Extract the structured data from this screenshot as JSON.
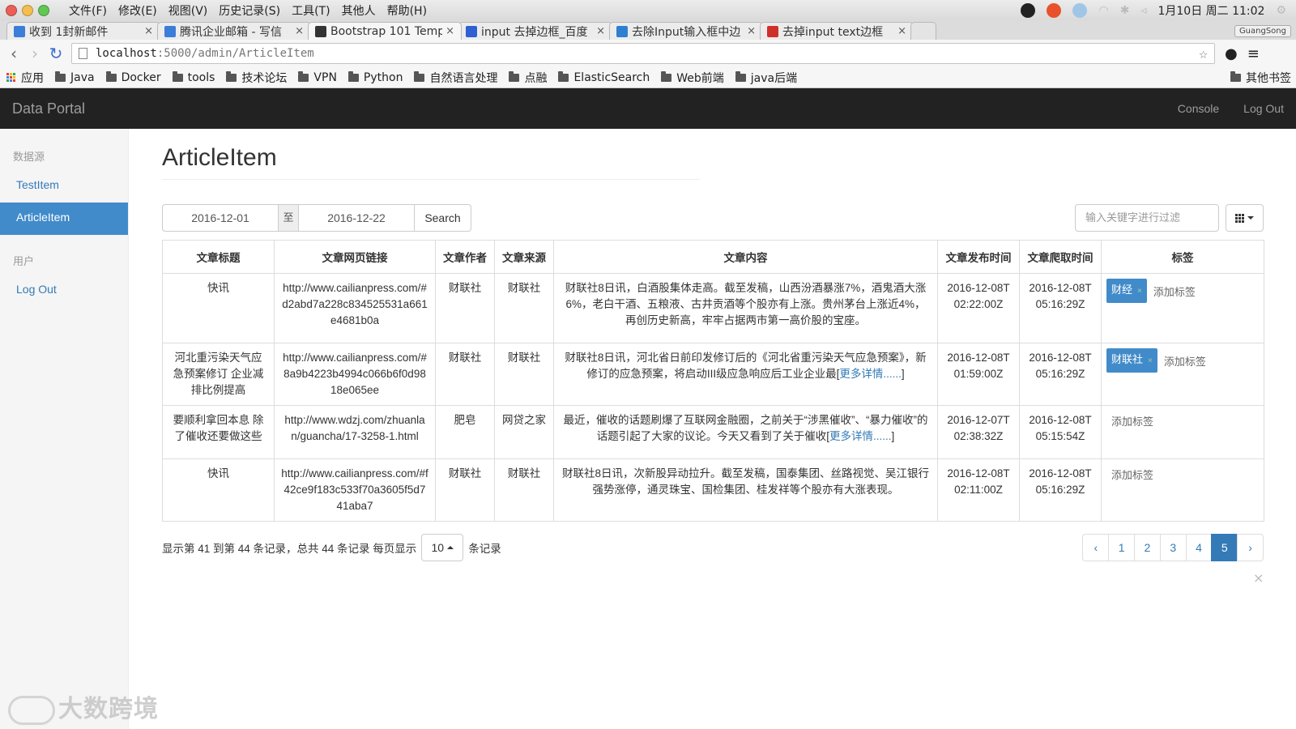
{
  "os_bar": {
    "menus": [
      "文件(F)",
      "修改(E)",
      "视图(V)",
      "历史记录(S)",
      "工具(T)",
      "其他人",
      "帮助(H)"
    ],
    "clock": "1月10日 周二 11:02"
  },
  "tabs": [
    {
      "title": "收到 1封新邮件",
      "favicon_color": "#3b7dd8"
    },
    {
      "title": "腾讯企业邮箱 - 写信",
      "favicon_color": "#3b7dd8"
    },
    {
      "title": "Bootstrap 101 Templ",
      "favicon_color": "#333333"
    },
    {
      "title": "input 去掉边框_百度",
      "favicon_color": "#2f5fd1"
    },
    {
      "title": "去除Input输入框中边",
      "favicon_color": "#2f7fd1"
    },
    {
      "title": "去掉input text边框",
      "favicon_color": "#d0302a"
    }
  ],
  "profile_name": "GuangSong",
  "address": {
    "host": "localhost",
    "rest": ":5000/admin/ArticleItem"
  },
  "bookmarks": [
    "应用",
    "Java",
    "Docker",
    "tools",
    "技术论坛",
    "VPN",
    "Python",
    "自然语言处理",
    "点融",
    "ElasticSearch",
    "Web前端",
    "java后端"
  ],
  "bookmarks_other": "其他书签",
  "navbar": {
    "brand": "Data Portal",
    "console": "Console",
    "logout": "Log Out"
  },
  "sidebar": {
    "section1": "数据源",
    "items1": [
      "TestItem",
      "ArticleItem"
    ],
    "section2": "用户",
    "items2": [
      "Log Out"
    ]
  },
  "page_title": "ArticleItem",
  "toolbar": {
    "date_from": "2016-12-01",
    "separator": "至",
    "date_to": "2016-12-22",
    "search": "Search",
    "filter_placeholder": "输入关键字进行过滤"
  },
  "table": {
    "headers": [
      "文章标题",
      "文章网页链接",
      "文章作者",
      "文章来源",
      "文章内容",
      "文章发布时间",
      "文章爬取时间",
      "标签"
    ],
    "rows": [
      {
        "title": "快讯",
        "link": "http://www.cailianpress.com/#d2abd7a228c834525531a661e4681b0a",
        "author": "财联社",
        "source": "财联社",
        "content": "财联社8日讯，白酒股集体走高。截至发稿，山西汾酒暴涨7%，酒鬼酒大涨6%，老白干酒、五粮液、古井贡酒等个股亦有上涨。贵州茅台上涨近4%，再创历史新高，牢牢占据两市第一高价股的宝座。",
        "more": "",
        "published": "2016-12-08T02:22:00Z",
        "crawled": "2016-12-08T05:16:29Z",
        "tag": "财经",
        "add_tag": "添加标签"
      },
      {
        "title": "河北重污染天气应急预案修订 企业减排比例提高",
        "link": "http://www.cailianpress.com/#8a9b4223b4994c066b6f0d9818e065ee",
        "author": "财联社",
        "source": "财联社",
        "content": "财联社8日讯，河北省日前印发修订后的《河北省重污染天气应急预案》，新修订的应急预案，将启动III级应急响应后工业企业最[",
        "more": "更多详情......",
        "published": "2016-12-08T01:59:00Z",
        "crawled": "2016-12-08T05:16:29Z",
        "tag": "财联社",
        "add_tag": "添加标签"
      },
      {
        "title": "要顺利拿回本息 除了催收还要做这些",
        "link": "http://www.wdzj.com/zhuanlan/guancha/17-3258-1.html",
        "author": "肥皂",
        "source": "网贷之家",
        "content": "最近，催收的话题刷爆了互联网金融圈，之前关于“涉黑催收”、“暴力催收”的话题引起了大家的议论。今天又看到了关于催收[",
        "more": "更多详情......",
        "published": "2016-12-07T02:38:32Z",
        "crawled": "2016-12-08T05:15:54Z",
        "tag": "",
        "add_tag": "添加标签"
      },
      {
        "title": "快讯",
        "link": "http://www.cailianpress.com/#f42ce9f183c533f70a3605f5d741aba7",
        "author": "财联社",
        "source": "财联社",
        "content": "财联社8日讯，次新股异动拉升。截至发稿，国泰集团、丝路视觉、吴江银行强势涨停，通灵珠宝、国检集团、桂发祥等个股亦有大涨表现。",
        "more": "",
        "published": "2016-12-08T02:11:00Z",
        "crawled": "2016-12-08T05:16:29Z",
        "tag": "",
        "add_tag": "添加标签"
      }
    ]
  },
  "footer": {
    "info_prefix": "显示第 41 到第 44 条记录，总共 44 条记录 每页显示",
    "page_size": "10",
    "info_suffix": "条记录",
    "pages": [
      "‹",
      "1",
      "2",
      "3",
      "4",
      "5",
      "›"
    ],
    "active_page": "5"
  },
  "dismiss": "×",
  "watermark": "大数跨境",
  "colors": {
    "navbar_bg": "#222222",
    "sidebar_active": "#428bca",
    "link": "#337ab7"
  }
}
